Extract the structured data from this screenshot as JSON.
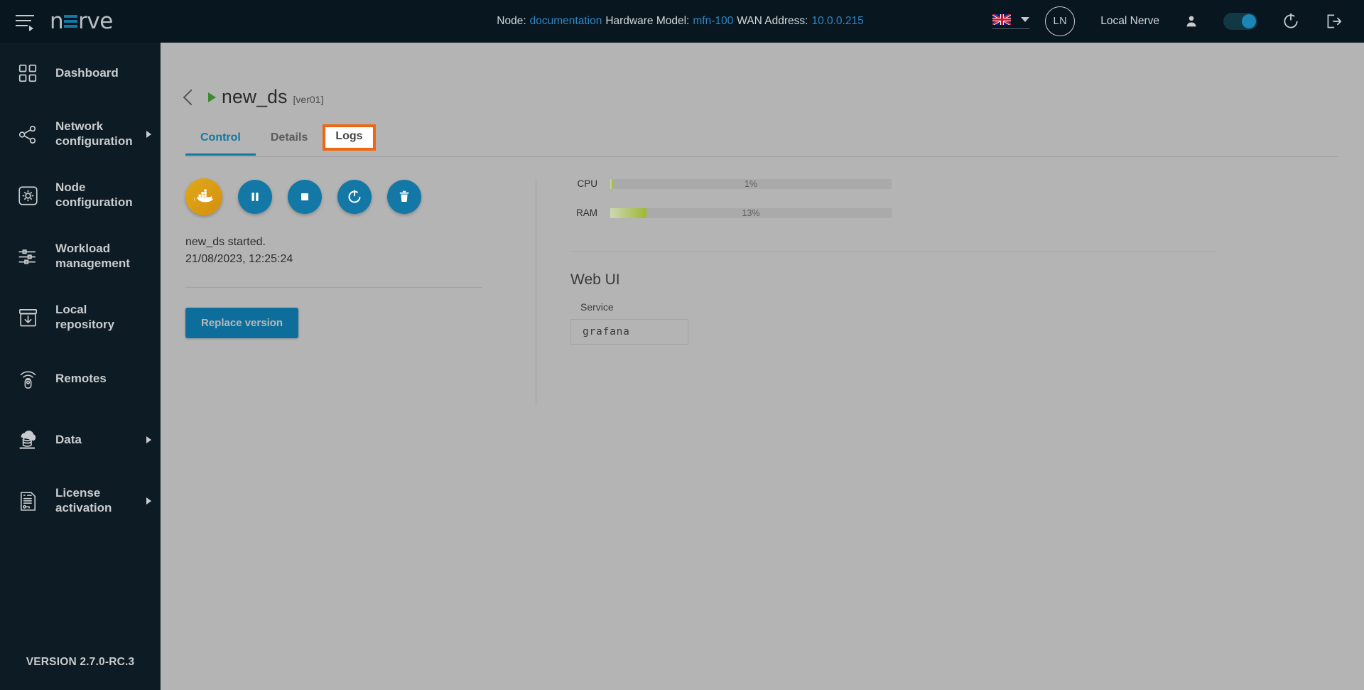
{
  "topbar": {
    "menu_icon": "hamburger-menu-icon",
    "logo_text_pre": "n",
    "logo_text_post": "rve",
    "node_label": "Node:",
    "node_value": "documentation",
    "hardware_label": "Hardware Model:",
    "hardware_value": "mfn-100",
    "wan_label": "WAN Address:",
    "wan_value": "10.0.0.215",
    "language_flag": "uk-flag-icon",
    "language_caret": "chevron-down-icon",
    "avatar_initials": "LN",
    "username": "Local Nerve",
    "user_icon": "person-icon",
    "toggle_state": "on",
    "refresh_icon": "refresh-icon",
    "logout_icon": "logout-icon"
  },
  "sidebar": {
    "items": [
      {
        "label": "Dashboard",
        "icon": "dashboard-grid-icon",
        "has_arrow": false
      },
      {
        "label": "Network configuration",
        "icon": "network-share-icon",
        "has_arrow": true
      },
      {
        "label": "Node configuration",
        "icon": "node-gear-icon",
        "has_arrow": false
      },
      {
        "label": "Workload management",
        "icon": "sliders-icon",
        "has_arrow": false
      },
      {
        "label": "Local repository",
        "icon": "repository-download-icon",
        "has_arrow": false
      },
      {
        "label": "Remotes",
        "icon": "remote-control-icon",
        "has_arrow": false
      },
      {
        "label": "Data",
        "icon": "cloud-database-icon",
        "has_arrow": true
      },
      {
        "label": "License activation",
        "icon": "license-document-icon",
        "has_arrow": true
      }
    ],
    "version": "VERSION 2.7.0-RC.3"
  },
  "page": {
    "back_icon": "chevron-left-icon",
    "status_icon": "play-triangle-icon",
    "title": "new_ds",
    "version_tag": "[ver01]"
  },
  "tabs": [
    {
      "label": "Control",
      "state": "active"
    },
    {
      "label": "Details",
      "state": "normal"
    },
    {
      "label": "Logs",
      "state": "highlighted"
    }
  ],
  "control": {
    "buttons": [
      {
        "name": "docker-whale-icon",
        "title": "Docker"
      },
      {
        "name": "pause-icon",
        "title": "Pause"
      },
      {
        "name": "stop-icon",
        "title": "Stop"
      },
      {
        "name": "restart-icon",
        "title": "Restart"
      },
      {
        "name": "delete-trash-icon",
        "title": "Delete"
      }
    ],
    "status_message": "new_ds started.",
    "status_timestamp": "21/08/2023, 12:25:24",
    "replace_button": "Replace version"
  },
  "metrics": [
    {
      "label": "CPU",
      "value": 1,
      "text": "1%"
    },
    {
      "label": "RAM",
      "value": 13,
      "text": "13%"
    }
  ],
  "webui": {
    "title": "Web UI",
    "service_label": "Service",
    "service_value": "grafana"
  },
  "colors": {
    "accent": "#1378a5",
    "highlight": "#f26611",
    "dark_bg": "#081620",
    "sidebar_bg": "#0d1b24",
    "main_bg": "#b4b4b4",
    "meter_green": "#9cba31",
    "docker_gold": "#d4900e"
  }
}
